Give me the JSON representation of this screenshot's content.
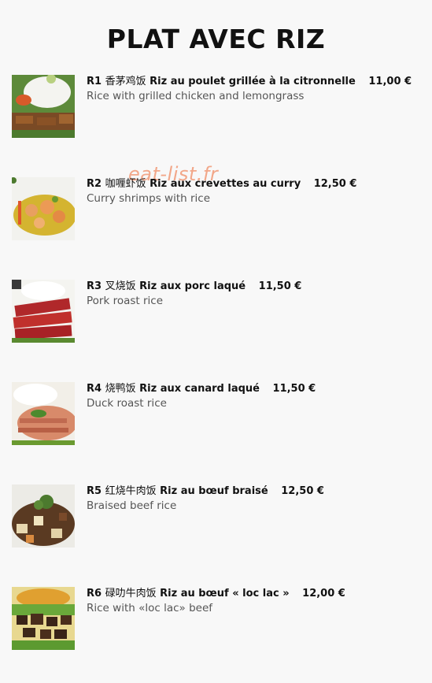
{
  "page": {
    "title": "PLAT AVEC RIZ",
    "watermark": "eat-list.fr"
  },
  "items": [
    {
      "code": "R1",
      "chinese": "香茅鸡饭",
      "french": "Riz au poulet grillée à la citronnelle",
      "price": "11,00 €",
      "english": "Rice with grilled chicken and lemongrass"
    },
    {
      "code": "R2",
      "chinese": "咖喱虾饭",
      "french": "Riz aux crevettes au curry",
      "price": "12,50 €",
      "english": "Curry shrimps with rice"
    },
    {
      "code": "R3",
      "chinese": "叉烧饭",
      "french": "Riz aux porc laqué",
      "price": "11,50 €",
      "english": "Pork roast rice"
    },
    {
      "code": "R4",
      "chinese": "烧鸭饭",
      "french": "Riz aux canard laqué",
      "price": "11,50 €",
      "english": "Duck roast rice"
    },
    {
      "code": "R5",
      "chinese": "红烧牛肉饭",
      "french": "Riz au bœuf braisé",
      "price": "12,50 €",
      "english": "Braised beef rice"
    },
    {
      "code": "R6",
      "chinese": "碌叻牛肉饭",
      "french": "Riz au bœuf « loc lac »",
      "price": "12,00 €",
      "english": "Rice with «loc lac» beef"
    }
  ]
}
